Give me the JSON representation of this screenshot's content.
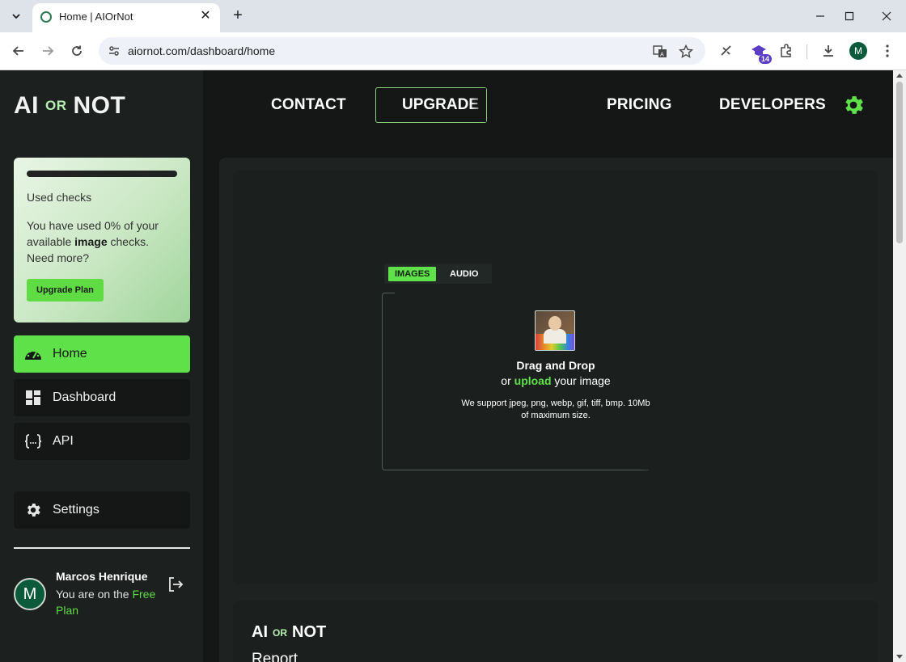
{
  "browser": {
    "tab_title": "Home | AIOrNot",
    "url": "aiornot.com/dashboard/home",
    "extension_badge": "14",
    "profile_initial": "M"
  },
  "logo": {
    "left": "AI",
    "middle": "OR",
    "right": "NOT"
  },
  "topnav": {
    "contact": "CONTACT",
    "upgrade": "UPGRADE",
    "pricing": "PRICING",
    "developers": "DEVELOPERS"
  },
  "usage": {
    "title": "Used checks",
    "text_before": "You have used 0% of your available ",
    "text_bold": "image",
    "text_after": " checks. Need more?",
    "button": "Upgrade Plan",
    "used_fraction": 0.0
  },
  "sidebar": {
    "items": [
      {
        "label": "Home",
        "icon": "speedometer-icon",
        "active": true
      },
      {
        "label": "Dashboard",
        "icon": "dashboard-grid-icon",
        "active": false
      },
      {
        "label": "API",
        "icon": "code-braces-icon",
        "active": false
      },
      {
        "label": "Settings",
        "icon": "gear-icon",
        "active": false
      }
    ]
  },
  "user": {
    "initial": "M",
    "name": "Marcos Henrique",
    "plan_prefix": "You are on the ",
    "plan_name": "Free Plan"
  },
  "upload": {
    "tab_images": "IMAGES",
    "tab_audio": "AUDIO",
    "drag_title": "Drag and Drop",
    "or": "or ",
    "upload_link": "upload",
    "your_image": " your image",
    "support": "We support jpeg, png, webp, gif, tiff, bmp. 10Mb of maximum size."
  },
  "report": {
    "logo_left": "AI",
    "logo_middle": "OR",
    "logo_right": "NOT",
    "title": "Report"
  },
  "colors": {
    "accent": "#5fe14a",
    "page_bg": "#141716",
    "sidebar_bg": "#1c211f"
  }
}
